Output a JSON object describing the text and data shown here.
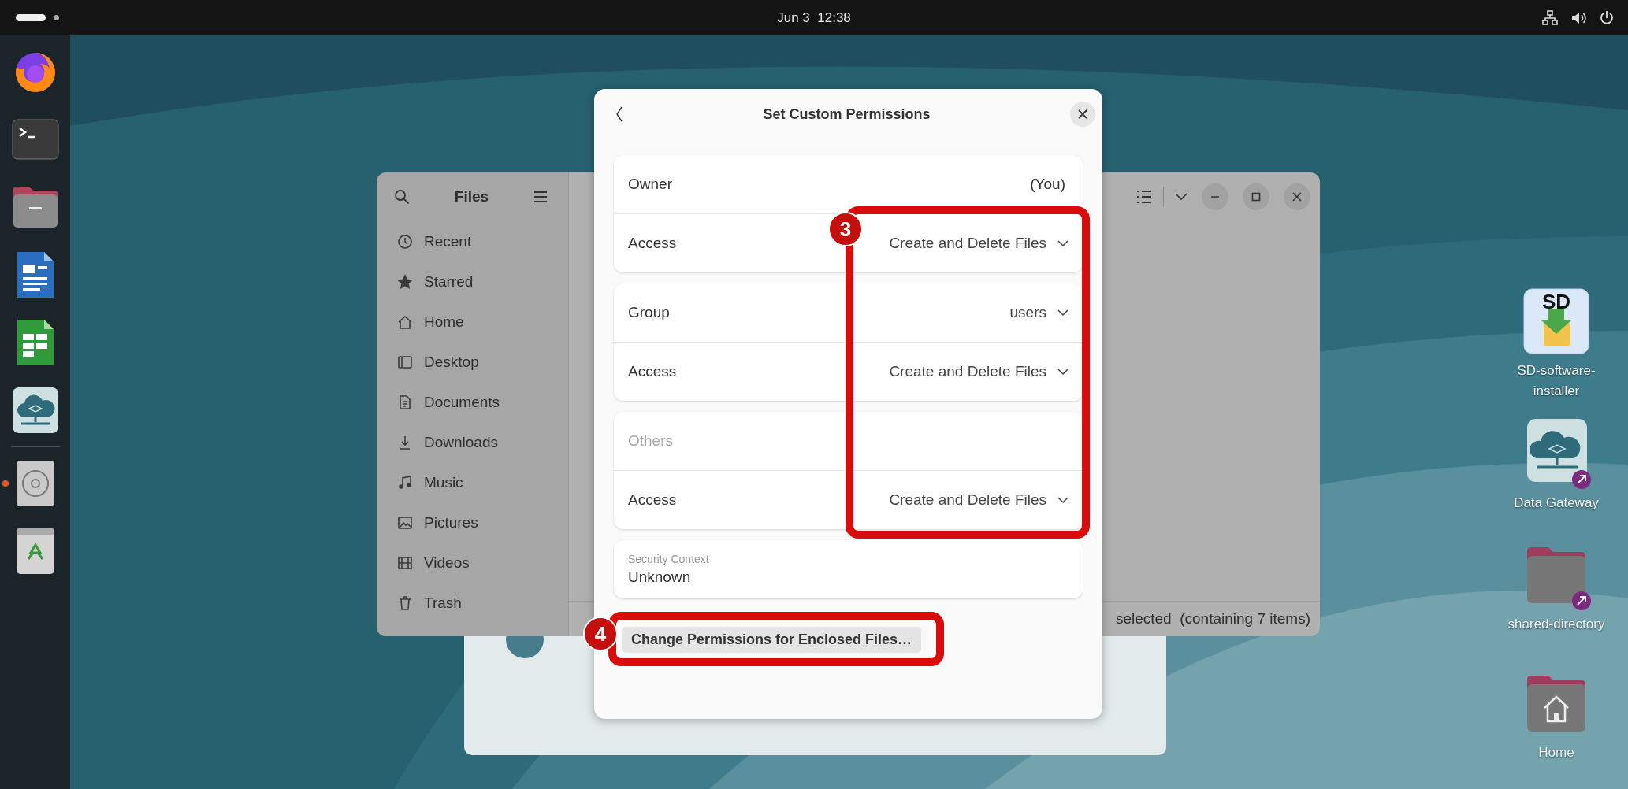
{
  "top_bar": {
    "clock": "Jun 3  12:38"
  },
  "dock": {
    "apps": [
      {
        "kind": "firefox",
        "running": false
      },
      {
        "kind": "terminal",
        "running": false
      },
      {
        "kind": "files",
        "running": false
      },
      {
        "kind": "writer",
        "running": false
      },
      {
        "kind": "calc",
        "running": false
      },
      {
        "kind": "cloud",
        "running": false
      }
    ],
    "more_apps": [
      {
        "kind": "disc",
        "running": true
      },
      {
        "kind": "trash",
        "running": false
      }
    ]
  },
  "files_window": {
    "title": "Files",
    "sidebar": {
      "items": [
        {
          "label": "Recent",
          "kind": "recent"
        },
        {
          "label": "Starred",
          "kind": "starred"
        },
        {
          "label": "Home",
          "kind": "home"
        },
        {
          "label": "Desktop",
          "kind": "desktop"
        },
        {
          "label": "Documents",
          "kind": "documents"
        },
        {
          "label": "Downloads",
          "kind": "downloads"
        },
        {
          "label": "Music",
          "kind": "music"
        },
        {
          "label": "Pictures",
          "kind": "pictures"
        },
        {
          "label": "Videos",
          "kind": "videos"
        },
        {
          "label": "Trash",
          "kind": "trash"
        }
      ]
    },
    "status_bar": "selected  (containing 7 items)"
  },
  "dialog": {
    "title": "Set Custom Permissions",
    "groups": [
      {
        "rows": [
          {
            "label": "Owner",
            "value": "(You)",
            "kind": "text",
            "disabled": false
          },
          {
            "label": "Access",
            "value": "Create and Delete Files",
            "kind": "dropdown",
            "disabled": false
          }
        ]
      },
      {
        "rows": [
          {
            "label": "Group",
            "value": "users",
            "kind": "dropdown",
            "disabled": false
          },
          {
            "label": "Access",
            "value": "Create and Delete Files",
            "kind": "dropdown",
            "disabled": false
          }
        ]
      },
      {
        "rows": [
          {
            "label": "Others",
            "kind": "text",
            "disabled": true
          },
          {
            "label": "Access",
            "value": "Create and Delete Files",
            "kind": "dropdown",
            "disabled": false
          }
        ]
      }
    ],
    "security_context": {
      "label": "Security Context",
      "value": "Unknown"
    },
    "button": "Change Permissions for Enclosed Files…"
  },
  "annotations": [
    {
      "label": "3"
    },
    {
      "label": "4"
    }
  ],
  "desktop_icons": [
    {
      "label": "SD-software-installer",
      "kind": "installer",
      "icon_text": "SD",
      "shortcut": false
    },
    {
      "label": "Data Gateway",
      "kind": "cloud",
      "shortcut": true
    },
    {
      "label": "shared-directory",
      "kind": "folder",
      "shortcut": true
    },
    {
      "label": "Home",
      "kind": "home-folder",
      "shortcut": false
    }
  ]
}
